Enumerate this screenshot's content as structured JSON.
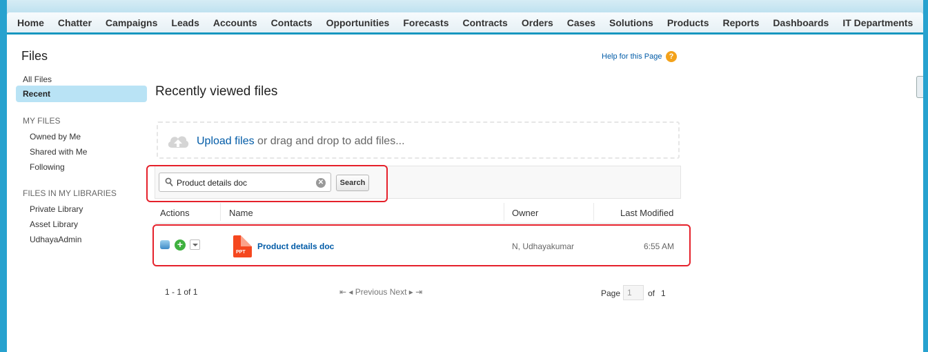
{
  "tabs": [
    "Home",
    "Chatter",
    "Campaigns",
    "Leads",
    "Accounts",
    "Contacts",
    "Opportunities",
    "Forecasts",
    "Contracts",
    "Orders",
    "Cases",
    "Solutions",
    "Products",
    "Reports",
    "Dashboards",
    "IT Departments"
  ],
  "tab_plus": "+",
  "page_title": "Files",
  "help_link": "Help for this Page",
  "help_icon_glyph": "?",
  "sidebar": {
    "all_files": "All Files",
    "recent": "Recent",
    "my_files_heading": "MY FILES",
    "my_files": [
      "Owned by Me",
      "Shared with Me",
      "Following"
    ],
    "libraries_heading": "FILES IN MY LIBRARIES",
    "libraries": [
      "Private Library",
      "Asset Library",
      "UdhayaAdmin"
    ]
  },
  "main_title": "Recently viewed files",
  "upload": {
    "link": "Upload files",
    "rest": " or drag and drop to add files..."
  },
  "search": {
    "value": "Product details doc",
    "button": "Search"
  },
  "table": {
    "headers": {
      "actions": "Actions",
      "name": "Name",
      "owner": "Owner",
      "modified": "Last Modified"
    },
    "rows": [
      {
        "name": "Product details doc",
        "type_label": "PPT",
        "owner": "N, Udhayakumar",
        "modified": "6:55 AM"
      }
    ]
  },
  "pager": {
    "count": "1 - 1 of 1",
    "nav": "⇤ ◂ Previous  Next ▸ ⇥",
    "page_label": "Page",
    "page_value": "1",
    "of_label": "of",
    "total": "1"
  },
  "colors": {
    "accent": "#1797c0",
    "link": "#015ba7",
    "highlight": "#e5202a",
    "recent_bg": "#b9e3f5"
  }
}
